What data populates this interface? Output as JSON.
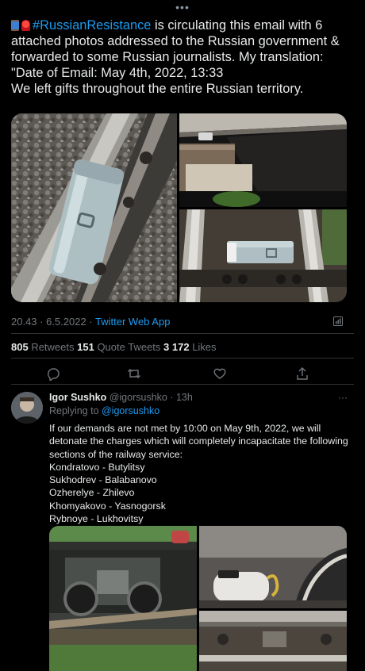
{
  "top_more": "•••",
  "tweet": {
    "hashtag": "#RussianResistance",
    "text_after_hashtag": " is circulating this email with 6 attached photos addressed to the Russian government & forwarded to some Russian journalists. My translation:",
    "line2": "\"Date of Email: May 4th, 2022, 13:33",
    "line3": "We left gifts throughout the entire Russian territory.",
    "emoji1": "spool-emoji",
    "emoji2": "siren-emoji",
    "time": "20.43 · 6.5.2022 · ",
    "source": "Twitter Web App",
    "stats": {
      "retweets_count": "805",
      "retweets_label": " Retweets ",
      "quotes_count": "151",
      "quotes_label": " Quote Tweets ",
      "likes_count": "3 172",
      "likes_label": " Likes"
    }
  },
  "reply": {
    "name": "Igor Sushko",
    "handle": " @igorsushko · 13h",
    "replying_prefix": "Replying to ",
    "replying_handle": "@igorsushko",
    "more": "···",
    "lines": [
      "If our demands are not met by 10:00 on May 9th, 2022, we will",
      "detonate the charges which will completely incapacitate the following",
      "sections of the railway service:",
      "Kondratovo - Butylitsy",
      "Sukhodrev - Balabanovo",
      "Ozherelye - Zhilevo",
      "Khomyakovo - Yasnogorsk",
      "Rybnoye - Lukhovitsy"
    ]
  },
  "colors": {
    "background": "#000000",
    "text": "#e7e9ea",
    "secondary": "#71767b",
    "accent": "#1d9bf0",
    "divider": "#2f3336"
  }
}
